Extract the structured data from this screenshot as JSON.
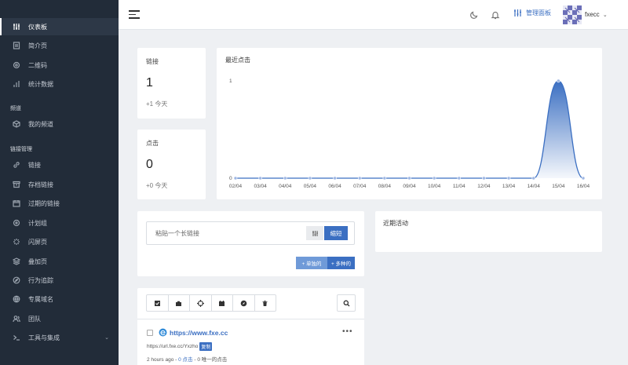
{
  "sidebar": {
    "items": [
      {
        "label": "仪表板",
        "icon": "sliders-icon"
      },
      {
        "label": "简介页",
        "icon": "page-icon"
      },
      {
        "label": "二维码",
        "icon": "qr-icon"
      },
      {
        "label": "统计数据",
        "icon": "bar-chart-icon"
      }
    ],
    "section_channels": "频道",
    "channel_items": [
      {
        "label": "我的频道",
        "icon": "box-icon"
      }
    ],
    "section_links": "链接管理",
    "link_items": [
      {
        "label": "链接",
        "icon": "link-icon"
      },
      {
        "label": "存档链接",
        "icon": "archive-icon"
      },
      {
        "label": "过期的链接",
        "icon": "calendar-icon"
      },
      {
        "label": "计划组",
        "icon": "target-icon"
      },
      {
        "label": "闪屏页",
        "icon": "sparkle-icon"
      },
      {
        "label": "叠加页",
        "icon": "layers-icon"
      },
      {
        "label": "行为追踪",
        "icon": "compass-icon"
      },
      {
        "label": "专属域名",
        "icon": "globe-icon"
      },
      {
        "label": "团队",
        "icon": "users-icon"
      },
      {
        "label": "工具与集成",
        "icon": "terminal-icon"
      }
    ]
  },
  "topbar": {
    "admin_label": "管理面板",
    "username": "fxecc"
  },
  "stats": {
    "links_label": "链接",
    "links_value": "1",
    "links_sub": "+1 今天",
    "clicks_label": "点击",
    "clicks_value": "0",
    "clicks_sub": "+0 今天"
  },
  "chart_title": "最近点击",
  "chart_data": {
    "type": "area",
    "categories": [
      "02/04",
      "03/04",
      "04/04",
      "05/04",
      "06/04",
      "07/04",
      "08/04",
      "09/04",
      "10/04",
      "11/04",
      "12/04",
      "13/04",
      "14/04",
      "15/04",
      "16/04"
    ],
    "values": [
      0,
      0,
      0,
      0,
      0,
      0,
      0,
      0,
      0,
      0,
      0,
      0,
      0,
      1,
      0
    ],
    "ylim": [
      0,
      1
    ],
    "yticks": [
      "0",
      "1"
    ],
    "color": "#3b6fc2"
  },
  "shorten": {
    "placeholder": "粘贴一个长链接",
    "button": "缩短",
    "single_button": "+ 单独的",
    "multi_button": "+ 多种的"
  },
  "recent_activity_title": "近期活动",
  "link_row": {
    "url": "https://www.fxe.cc",
    "short_url": "https://url.fxe.cc/Yxzho",
    "copy_label": "复制",
    "time": "2 hours ago",
    "clicks": "0 点击",
    "unique": "0 唯一的点击"
  }
}
